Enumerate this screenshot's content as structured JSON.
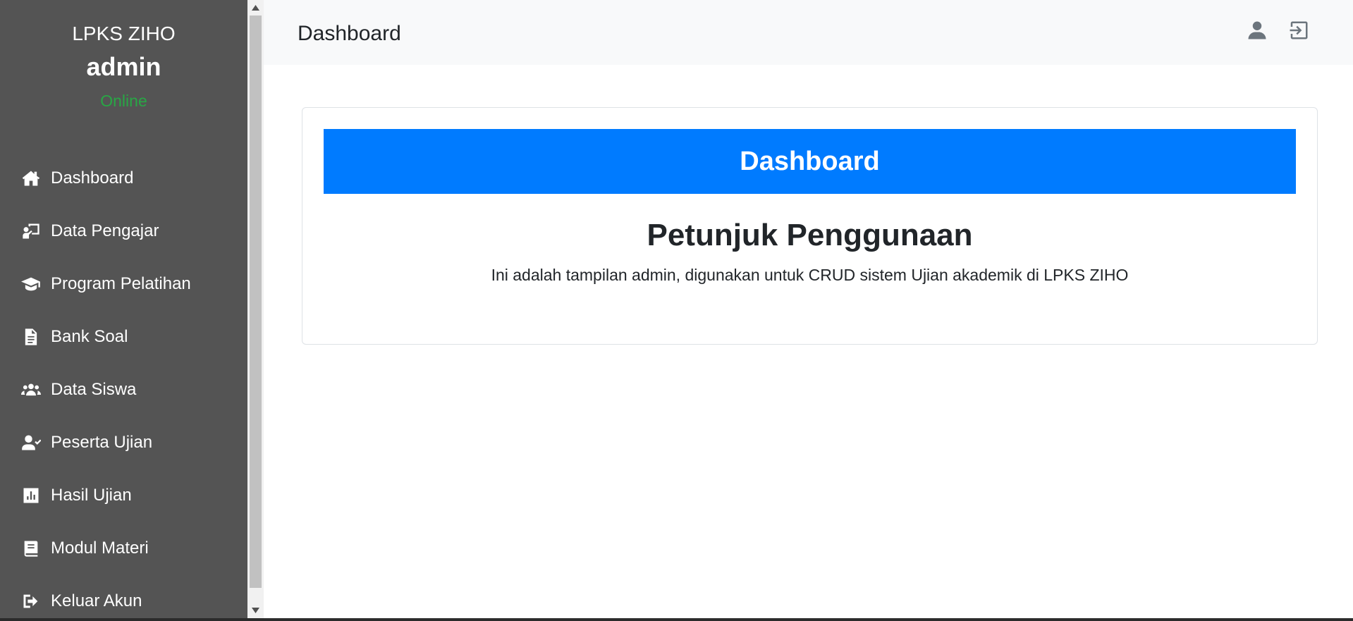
{
  "sidebar": {
    "org_name": "LPKS ZIHO",
    "user_name": "admin",
    "user_status": "Online",
    "items": [
      {
        "label": "Dashboard",
        "icon": "home-icon"
      },
      {
        "label": "Data Pengajar",
        "icon": "chalkboard-teacher-icon"
      },
      {
        "label": "Program Pelatihan",
        "icon": "graduation-cap-icon"
      },
      {
        "label": "Bank Soal",
        "icon": "file-icon"
      },
      {
        "label": "Data Siswa",
        "icon": "users-icon"
      },
      {
        "label": "Peserta Ujian",
        "icon": "user-check-icon"
      },
      {
        "label": "Hasil Ujian",
        "icon": "chart-icon"
      },
      {
        "label": "Modul Materi",
        "icon": "book-icon"
      },
      {
        "label": "Keluar Akun",
        "icon": "sign-out-icon"
      }
    ]
  },
  "header": {
    "title": "Dashboard",
    "user_icon": "user-icon",
    "logout_icon": "logout-icon"
  },
  "main": {
    "card_header": "Dashboard",
    "heading": "Petunjuk Penggunaan",
    "description": "Ini adalah tampilan admin, digunakan untuk CRUD sistem Ujian akademik di LPKS ZIHO"
  },
  "colors": {
    "sidebar_bg": "#545454",
    "status_online": "#28a745",
    "primary": "#007bff",
    "topbar_bg": "#f8f9fa"
  }
}
